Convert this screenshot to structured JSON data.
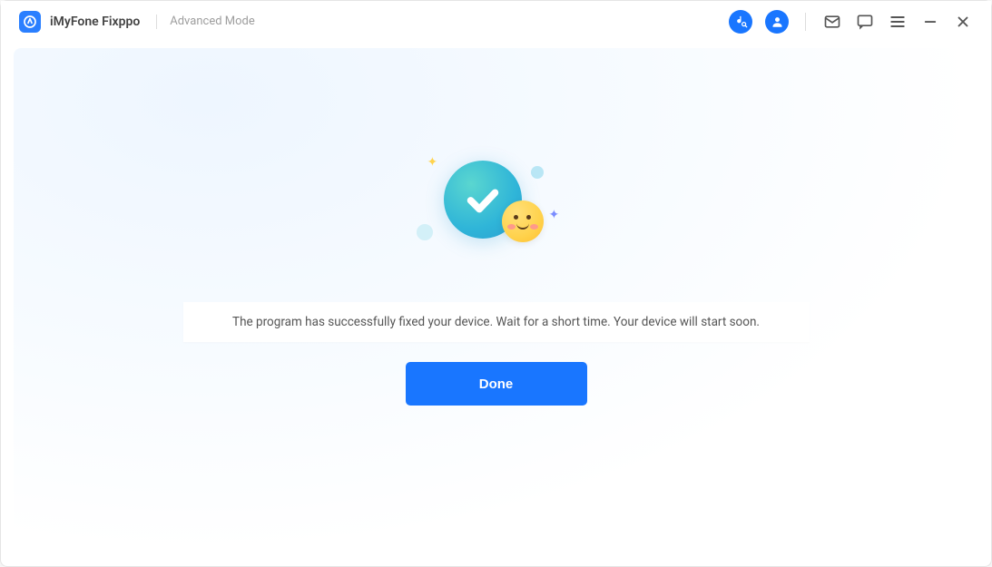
{
  "titlebar": {
    "app_name": "iMyFone Fixppo",
    "mode": "Advanced Mode",
    "icons": {
      "music": "music-search-icon",
      "account": "user-icon",
      "mail": "mail-icon",
      "feedback": "chat-icon",
      "menu": "menu-icon",
      "minimize": "minimize-icon",
      "close": "close-icon"
    }
  },
  "main": {
    "status_message": "The program has successfully fixed your device. Wait for a short time. Your device will start soon.",
    "done_label": "Done"
  }
}
